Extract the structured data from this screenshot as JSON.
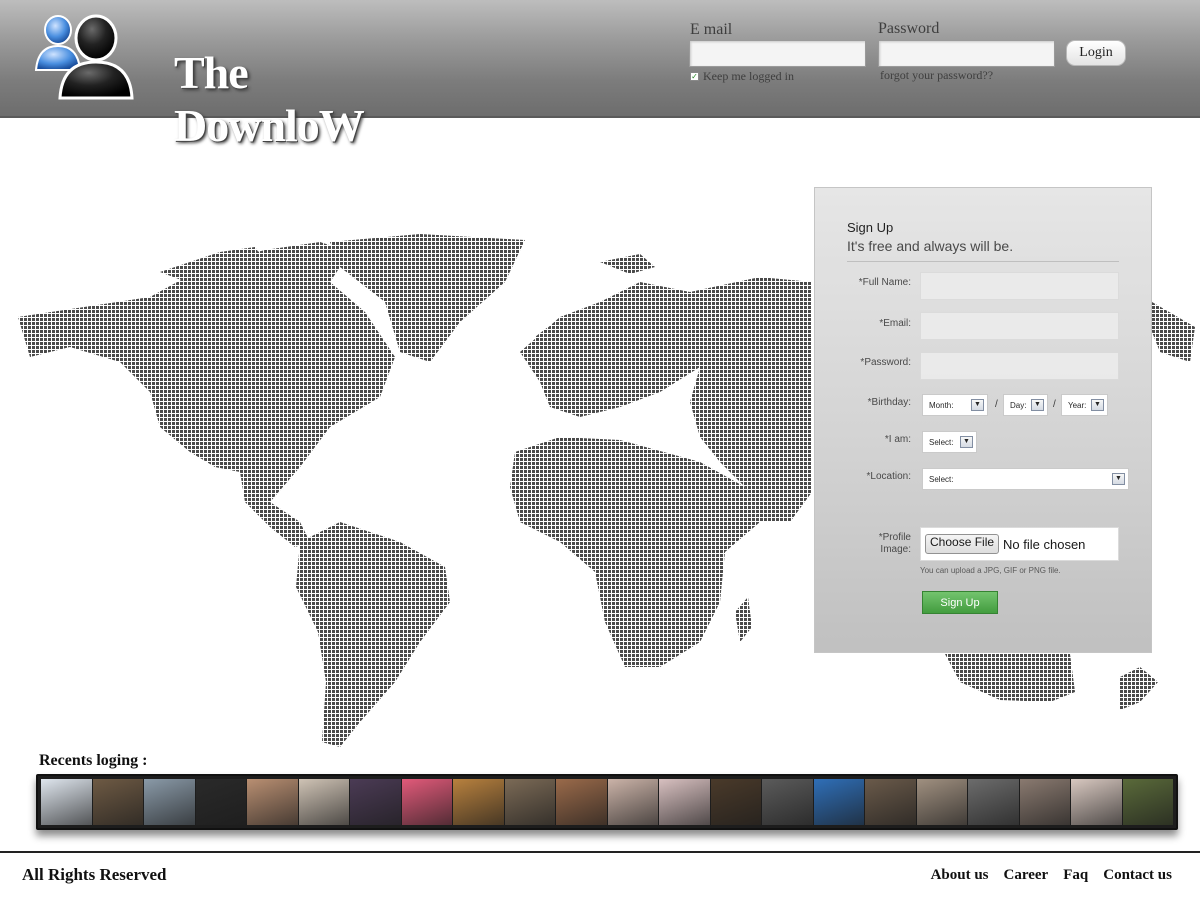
{
  "brand": {
    "name": "The DownloW",
    "icon": "two-users-icon"
  },
  "login": {
    "email_label": "E mail",
    "email_value": "",
    "password_label": "Password",
    "password_value": "",
    "login_button": "Login",
    "keep_logged_in": "Keep me logged in",
    "keep_logged_in_checked": true,
    "forgot_password": "forgot your password??"
  },
  "signup": {
    "title": "Sign Up",
    "subtitle": "It's free and always will be.",
    "full_name_label": "*Full Name:",
    "email_label": "*Email:",
    "password_label": "*Password:",
    "birthday_label": "*Birthday:",
    "birthday_month": "Month:",
    "birthday_day": "Day:",
    "birthday_year": "Year:",
    "birthday_separator": "/",
    "gender_label": "*I am:",
    "gender_value": "Select:",
    "location_label": "*Location:",
    "location_value": "Select:",
    "profile_image_label_1": "*Profile",
    "profile_image_label_2": "Image:",
    "choose_file_button": "Choose File",
    "no_file_text": "No file chosen",
    "upload_hint": "You can upload a JPG, GIF or PNG file.",
    "submit_button": "Sign Up"
  },
  "recents": {
    "title": "Recents loging :",
    "thumbnail_count": 22
  },
  "footer": {
    "rights": "All Rights Reserved",
    "links": [
      "About us",
      "Career",
      "Faq",
      "Contact us"
    ]
  },
  "colors": {
    "header_dark": "#6d6d6d",
    "header_light": "#bdbdbd",
    "map_dots": "#4a4a4a",
    "signup_button": "#4aa846"
  }
}
